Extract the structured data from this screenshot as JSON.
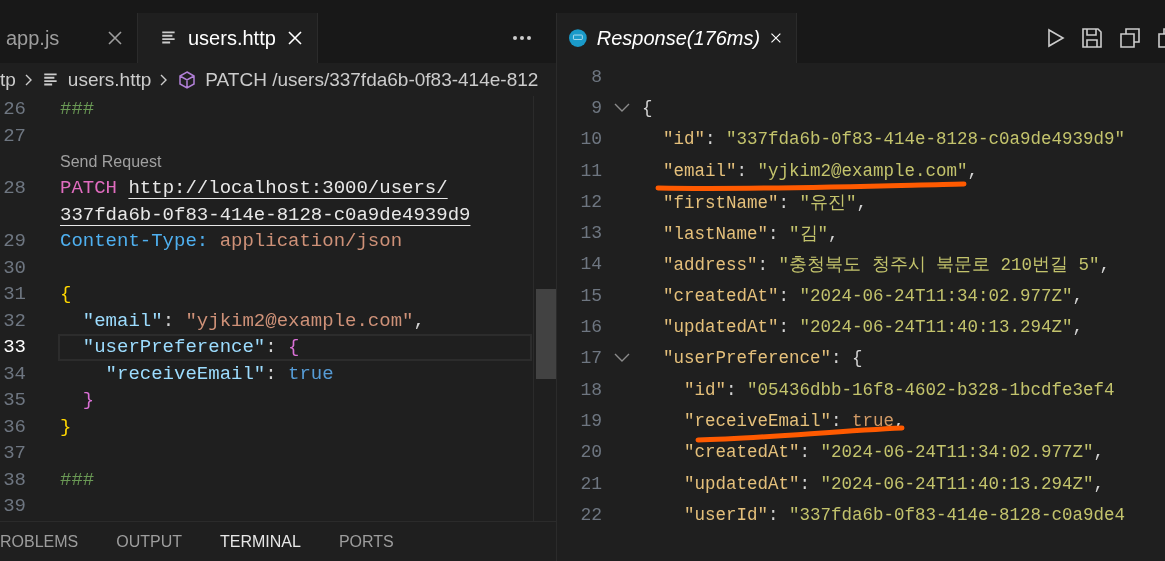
{
  "editor": {
    "tabs": [
      {
        "label": "app.js",
        "selected": false
      },
      {
        "label": "users.http",
        "selected": true
      }
    ],
    "breadcrumb": [
      "tp",
      "users.http",
      "PATCH /users/337fda6b-0f83-414e-812"
    ],
    "lines": [
      {
        "number": "26",
        "tokens": [
          {
            "t": "###",
            "kind": "comment"
          }
        ]
      },
      {
        "number": "27"
      },
      {
        "number": "28",
        "codelens": "Send Request",
        "tokens": [
          {
            "t": "PATCH ",
            "kind": "method"
          },
          {
            "t": "http://localhost:3000/users/",
            "kind": "url"
          }
        ],
        "wrap": [
          {
            "t": "337fda6b-0f83-414e-8128-c0a9de4939d9",
            "kind": "url"
          }
        ]
      },
      {
        "number": "29",
        "tokens": [
          {
            "t": "Content-Type: ",
            "kind": "header"
          },
          {
            "t": "application/json",
            "kind": "string"
          }
        ]
      },
      {
        "number": "30"
      },
      {
        "number": "31",
        "tokens": [
          {
            "t": "{",
            "kind": "brace1"
          }
        ]
      },
      {
        "number": "32",
        "tokens": [
          {
            "t": "  \"email\"",
            "kind": "key"
          },
          {
            "t": ": ",
            "kind": "plain"
          },
          {
            "t": "\"yjkim2@example.com\"",
            "kind": "string"
          },
          {
            "t": ",",
            "kind": "plain"
          }
        ]
      },
      {
        "number": "33",
        "current": true,
        "tokens": [
          {
            "t": "  \"userPreference\"",
            "kind": "key"
          },
          {
            "t": ": ",
            "kind": "plain"
          },
          {
            "t": "{",
            "kind": "brace2"
          }
        ]
      },
      {
        "number": "34",
        "tokens": [
          {
            "t": "    \"receiveEmail\"",
            "kind": "key"
          },
          {
            "t": ": ",
            "kind": "plain"
          },
          {
            "t": "true",
            "kind": "bool"
          }
        ]
      },
      {
        "number": "35",
        "tokens": [
          {
            "t": "  }",
            "kind": "brace2"
          }
        ]
      },
      {
        "number": "36",
        "tokens": [
          {
            "t": "}",
            "kind": "brace1"
          }
        ]
      },
      {
        "number": "37"
      },
      {
        "number": "38",
        "tokens": [
          {
            "t": "###",
            "kind": "comment"
          }
        ]
      },
      {
        "number": "39"
      }
    ]
  },
  "response": {
    "tab": {
      "label": "Response(176ms)"
    },
    "lines": [
      {
        "number": "8"
      },
      {
        "number": "9",
        "fold": true,
        "tokens": [
          {
            "t": "{",
            "kind": "plain"
          }
        ]
      },
      {
        "number": "10",
        "tokens": [
          {
            "t": "  \"id\"",
            "kind": "key"
          },
          {
            "t": ": ",
            "kind": "plain"
          },
          {
            "t": "\"337fda6b-0f83-414e-8128-c0a9de4939d9\"",
            "kind": "string"
          }
        ]
      },
      {
        "number": "11",
        "tokens": [
          {
            "t": "  \"email\"",
            "kind": "key"
          },
          {
            "t": ": ",
            "kind": "plain"
          },
          {
            "t": "\"yjkim2@example.com\"",
            "kind": "string"
          },
          {
            "t": ",",
            "kind": "plain"
          }
        ]
      },
      {
        "number": "12",
        "tokens": [
          {
            "t": "  \"firstName\"",
            "kind": "key"
          },
          {
            "t": ": ",
            "kind": "plain"
          },
          {
            "t": "\"유진\"",
            "kind": "string"
          },
          {
            "t": ",",
            "kind": "plain"
          }
        ]
      },
      {
        "number": "13",
        "tokens": [
          {
            "t": "  \"lastName\"",
            "kind": "key"
          },
          {
            "t": ": ",
            "kind": "plain"
          },
          {
            "t": "\"김\"",
            "kind": "string"
          },
          {
            "t": ",",
            "kind": "plain"
          }
        ]
      },
      {
        "number": "14",
        "tokens": [
          {
            "t": "  \"address\"",
            "kind": "key"
          },
          {
            "t": ": ",
            "kind": "plain"
          },
          {
            "t": "\"충청북도 청주시 북문로 210번길 5\"",
            "kind": "string"
          },
          {
            "t": ",",
            "kind": "plain"
          }
        ]
      },
      {
        "number": "15",
        "tokens": [
          {
            "t": "  \"createdAt\"",
            "kind": "key"
          },
          {
            "t": ": ",
            "kind": "plain"
          },
          {
            "t": "\"2024-06-24T11:34:02.977Z\"",
            "kind": "string"
          },
          {
            "t": ",",
            "kind": "plain"
          }
        ]
      },
      {
        "number": "16",
        "tokens": [
          {
            "t": "  \"updatedAt\"",
            "kind": "key"
          },
          {
            "t": ": ",
            "kind": "plain"
          },
          {
            "t": "\"2024-06-24T11:40:13.294Z\"",
            "kind": "string"
          },
          {
            "t": ",",
            "kind": "plain"
          }
        ]
      },
      {
        "number": "17",
        "fold": true,
        "tokens": [
          {
            "t": "  \"userPreference\"",
            "kind": "key"
          },
          {
            "t": ": ",
            "kind": "plain"
          },
          {
            "t": "{",
            "kind": "plain"
          }
        ]
      },
      {
        "number": "18",
        "tokens": [
          {
            "t": "    \"id\"",
            "kind": "key"
          },
          {
            "t": ": ",
            "kind": "plain"
          },
          {
            "t": "\"05436dbb-16f8-4602-b328-1bcdfe3ef4",
            "kind": "string"
          }
        ]
      },
      {
        "number": "19",
        "tokens": [
          {
            "t": "    \"receiveEmail\"",
            "kind": "key"
          },
          {
            "t": ": ",
            "kind": "plain"
          },
          {
            "t": "true",
            "kind": "bool"
          },
          {
            "t": ",",
            "kind": "plain"
          }
        ]
      },
      {
        "number": "20",
        "tokens": [
          {
            "t": "    \"createdAt\"",
            "kind": "key"
          },
          {
            "t": ": ",
            "kind": "plain"
          },
          {
            "t": "\"2024-06-24T11:34:02.977Z\"",
            "kind": "string"
          },
          {
            "t": ",",
            "kind": "plain"
          }
        ]
      },
      {
        "number": "21",
        "tokens": [
          {
            "t": "    \"updatedAt\"",
            "kind": "key"
          },
          {
            "t": ": ",
            "kind": "plain"
          },
          {
            "t": "\"2024-06-24T11:40:13.294Z\"",
            "kind": "string"
          },
          {
            "t": ",",
            "kind": "plain"
          }
        ]
      },
      {
        "number": "22",
        "tokens": [
          {
            "t": "    \"userId\"",
            "kind": "key"
          },
          {
            "t": ": ",
            "kind": "plain"
          },
          {
            "t": "\"337fda6b-0f83-414e-8128-c0a9de4",
            "kind": "string"
          }
        ]
      }
    ]
  },
  "panel_tabs": [
    {
      "label": "ROBLEMS",
      "selected": false
    },
    {
      "label": "OUTPUT",
      "selected": false
    },
    {
      "label": "TERMINAL",
      "selected": true
    },
    {
      "label": "PORTS",
      "selected": false
    }
  ]
}
